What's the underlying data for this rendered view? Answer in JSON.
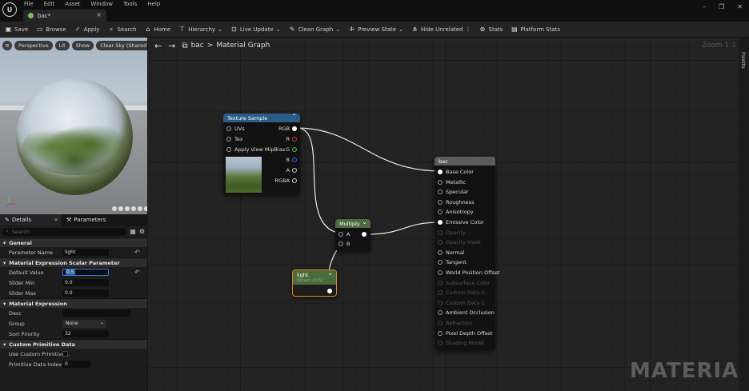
{
  "app": {
    "menus": [
      "File",
      "Edit",
      "Asset",
      "Window",
      "Tools",
      "Help"
    ],
    "tab_title": "bac*"
  },
  "toolbar": {
    "items": [
      {
        "name": "save",
        "label": "Save",
        "icon": "floppy-icon"
      },
      {
        "name": "browse",
        "label": "Browse",
        "icon": "folder-icon"
      },
      {
        "name": "apply",
        "label": "Apply",
        "icon": "check-icon"
      },
      {
        "name": "search",
        "label": "Search",
        "icon": "search-icon"
      },
      {
        "name": "home",
        "label": "Home",
        "icon": "home-icon"
      },
      {
        "name": "hierarchy",
        "label": "Hierarchy",
        "icon": "hierarchy-icon",
        "dropdown": true
      },
      {
        "name": "live-update",
        "label": "Live Update",
        "icon": "live-update-icon",
        "dropdown": true
      },
      {
        "name": "clean-graph",
        "label": "Clean Graph",
        "icon": "broom-icon",
        "dropdown": true
      },
      {
        "name": "preview-state",
        "label": "Preview State",
        "icon": "preview-icon",
        "dropdown": true
      },
      {
        "name": "hide-unrelated",
        "label": "Hide Unrelated",
        "icon": "hide-icon",
        "dropdown": false
      },
      {
        "name": "stats",
        "label": "Stats",
        "icon": "stats-icon"
      },
      {
        "name": "platform-stats",
        "label": "Platform Stats",
        "icon": "platform-icon"
      }
    ]
  },
  "viewport": {
    "buttons": [
      "Perspective",
      "Lit",
      "Show",
      "Clear Sky (Shared)"
    ]
  },
  "details": {
    "tabs": [
      "Details",
      "Parameters"
    ],
    "search_placeholder": "Search",
    "sections": {
      "general": "General",
      "scalar": "Material Expression Scalar Parameter",
      "expression": "Material Expression",
      "custom": "Custom Primitive Data"
    },
    "props": {
      "parameter_name": {
        "label": "Parameter Name",
        "value": "light"
      },
      "default_value": {
        "label": "Default Value",
        "value": "0.5"
      },
      "slider_min": {
        "label": "Slider Min",
        "value": "0.0"
      },
      "slider_max": {
        "label": "Slider Max",
        "value": "0.0"
      },
      "desc": {
        "label": "Desc",
        "value": ""
      },
      "group": {
        "label": "Group",
        "value": "None"
      },
      "sort_priority": {
        "label": "Sort Priority",
        "value": "32"
      },
      "use_custom_primitive": {
        "label": "Use Custom Primitive..."
      },
      "primitive_data_index": {
        "label": "Primitive Data Index",
        "value": "0"
      }
    }
  },
  "graph": {
    "breadcrumb_asset": "bac",
    "breadcrumb_sep": ">",
    "breadcrumb_page": "Material Graph",
    "zoom": "Zoom 1:1",
    "palette": "Palette",
    "watermark": "MATERIAL",
    "texture_node": {
      "title": "Texture Sample",
      "inputs": [
        "UVs",
        "Tex",
        "Apply View MipBias"
      ],
      "outputs": [
        "RGB",
        "R",
        "G",
        "B",
        "A",
        "RGBA"
      ]
    },
    "multiply_node": {
      "title": "Multiply",
      "inputs": [
        "A",
        "B"
      ]
    },
    "param_node": {
      "title": "light",
      "subtitle": "Param (0.5)"
    },
    "material_node": {
      "title": "bac",
      "pins": [
        {
          "label": "Base Color",
          "enabled": true
        },
        {
          "label": "Metallic",
          "enabled": true
        },
        {
          "label": "Specular",
          "enabled": true
        },
        {
          "label": "Roughness",
          "enabled": true
        },
        {
          "label": "Anisotropy",
          "enabled": true
        },
        {
          "label": "Emissive Color",
          "enabled": true
        },
        {
          "label": "Opacity",
          "enabled": false
        },
        {
          "label": "Opacity Mask",
          "enabled": false
        },
        {
          "label": "Normal",
          "enabled": true
        },
        {
          "label": "Tangent",
          "enabled": true
        },
        {
          "label": "World Position Offset",
          "enabled": true
        },
        {
          "label": "Subsurface Color",
          "enabled": false
        },
        {
          "label": "Custom Data 0",
          "enabled": false
        },
        {
          "label": "Custom Data 1",
          "enabled": false
        },
        {
          "label": "Ambient Occlusion",
          "enabled": true
        },
        {
          "label": "Refraction",
          "enabled": false
        },
        {
          "label": "Pixel Depth Offset",
          "enabled": true
        },
        {
          "label": "Shading Model",
          "enabled": false
        }
      ]
    }
  }
}
